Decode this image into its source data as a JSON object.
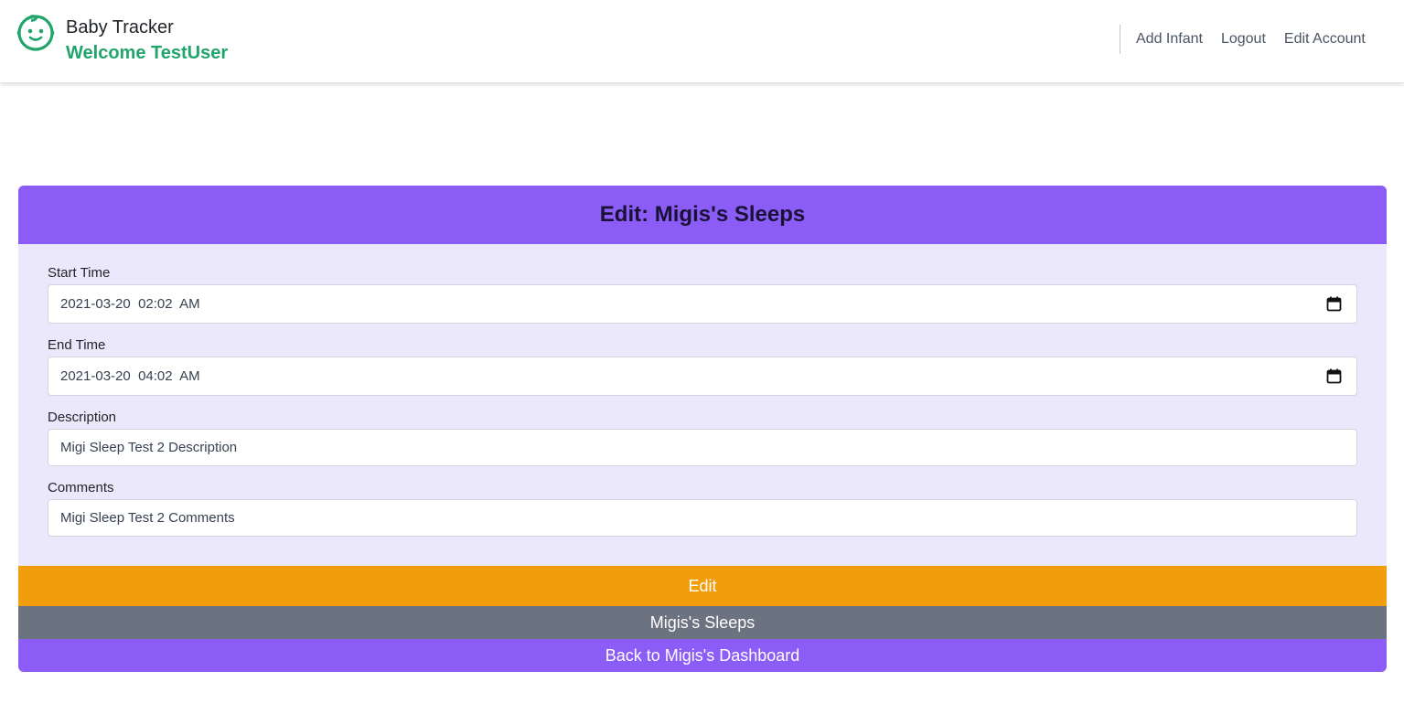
{
  "header": {
    "app_title": "Baby Tracker",
    "welcome": "Welcome TestUser",
    "logo_icon": "baby-face-icon",
    "accent_color": "#22a56b",
    "nav": {
      "add_infant": "Add Infant",
      "logout": "Logout",
      "edit_account": "Edit Account"
    }
  },
  "card": {
    "title": "Edit: Migis's Sleeps",
    "header_color": "#8b5cf6",
    "fields": {
      "start_time": {
        "label": "Start Time",
        "value": "2021-03-20  02:02  AM",
        "icon": "calendar-icon"
      },
      "end_time": {
        "label": "End Time",
        "value": "2021-03-20  04:02  AM",
        "icon": "calendar-icon"
      },
      "description": {
        "label": "Description",
        "value": "Migi Sleep Test 2 Description"
      },
      "comments": {
        "label": "Comments",
        "value": "Migi Sleep Test 2 Comments"
      }
    },
    "buttons": {
      "edit": "Edit",
      "sleeps": "Migis's Sleeps",
      "back": "Back to Migis's Dashboard"
    }
  }
}
